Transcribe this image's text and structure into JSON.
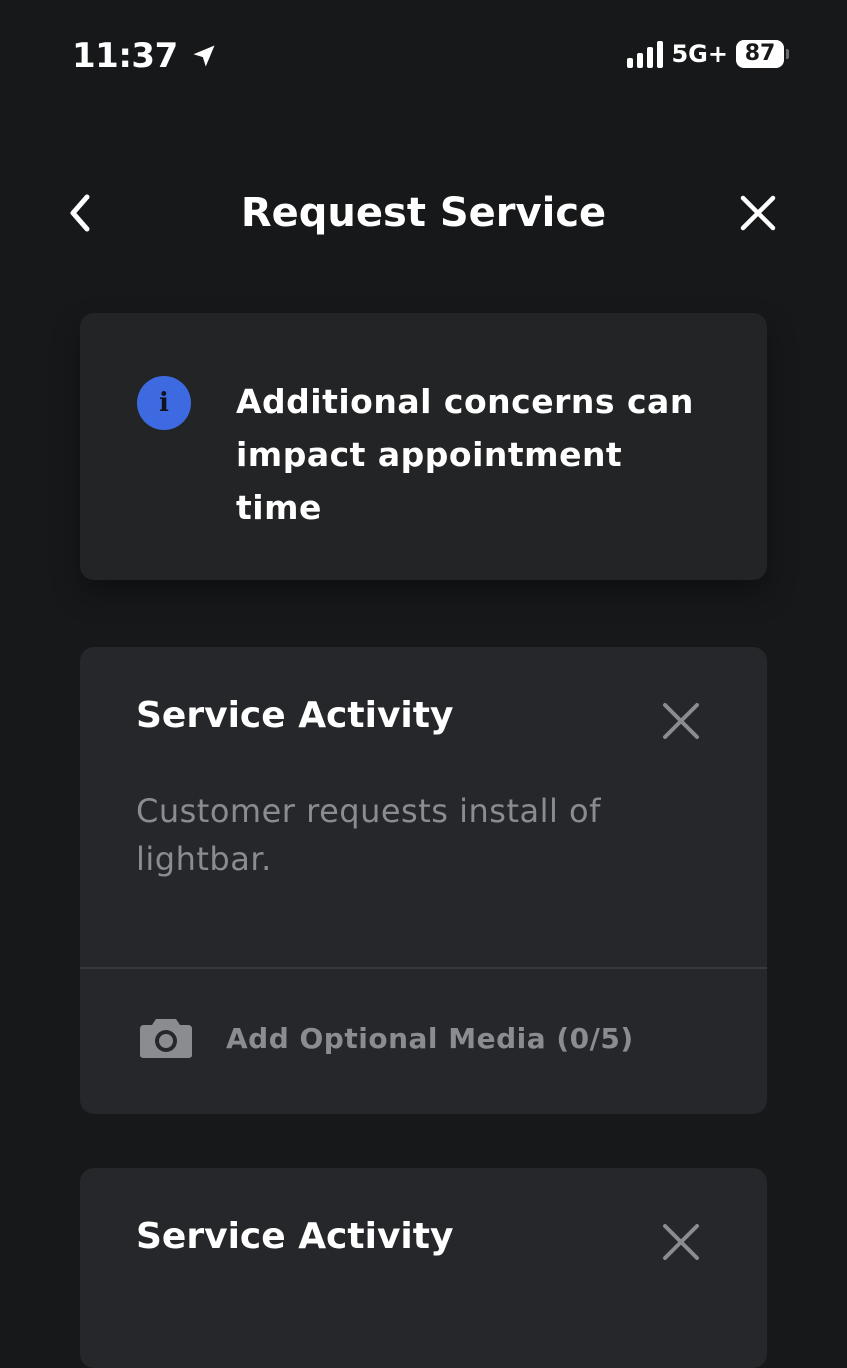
{
  "status_bar": {
    "time": "11:37",
    "network": "5G+",
    "battery": "87"
  },
  "nav": {
    "title": "Request Service"
  },
  "info": {
    "line1": "Additional concerns can",
    "line2": "impact appointment",
    "line3": "time"
  },
  "activities": [
    {
      "title": "Service Activity",
      "description": "Customer requests install of lightbar.",
      "media_label": "Add Optional Media (0/5)"
    },
    {
      "title": "Service Activity"
    }
  ],
  "colors": {
    "background": "#17181a",
    "card": "#26272a",
    "info_icon": "#3e6ae1",
    "muted_text": "#8b8c8f"
  },
  "icons": [
    "location-arrow-icon",
    "signal-icon",
    "battery-icon",
    "back-chevron-icon",
    "close-icon",
    "info-icon",
    "camera-icon"
  ]
}
